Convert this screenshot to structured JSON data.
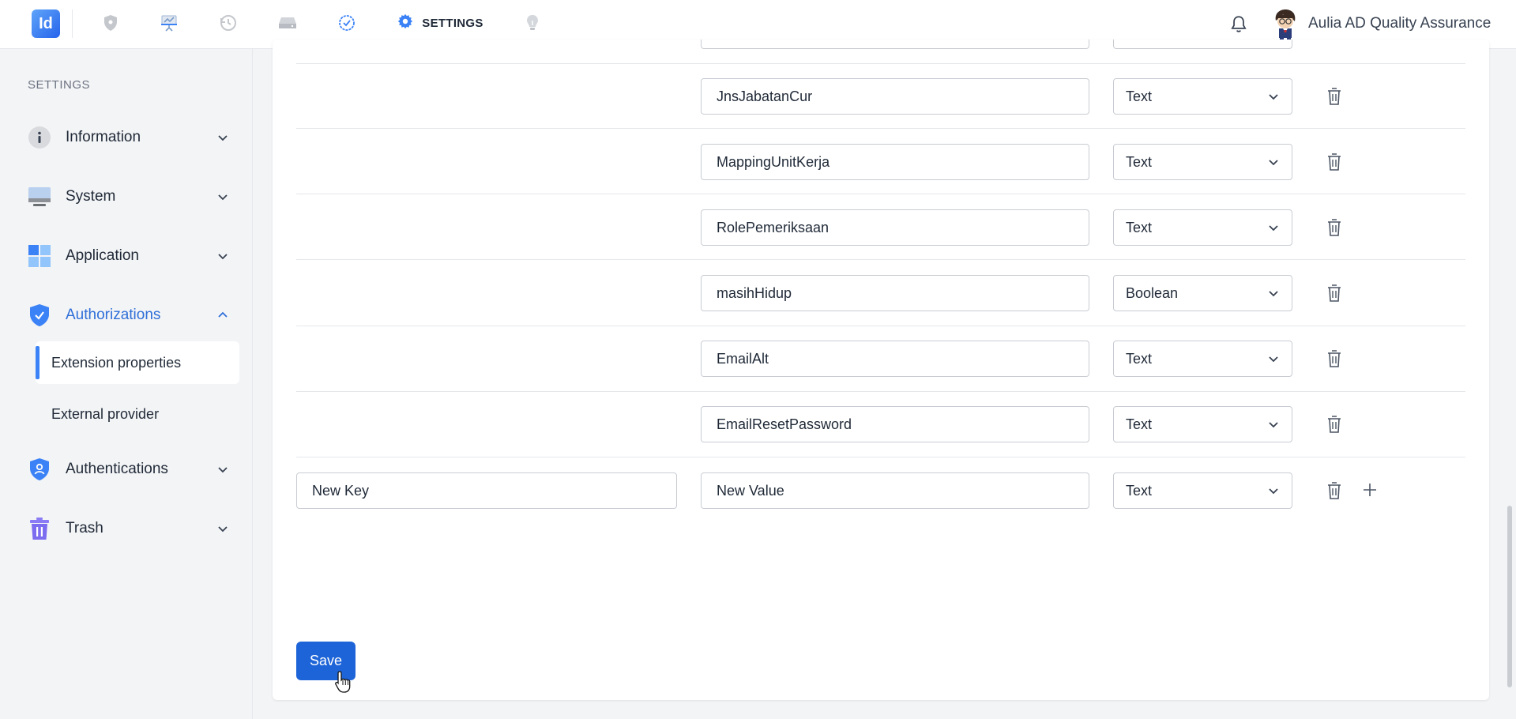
{
  "app": {
    "logo_text": "Id",
    "settings_tab_label": "SETTINGS",
    "user_name": "Aulia AD Quality Assurance",
    "accent_color": "#1d64d8",
    "nav_icons": [
      "shield-icon",
      "presentation-icon",
      "history-icon",
      "drive-icon",
      "check-circle-icon",
      "settings-gear-icon",
      "lightbulb-icon"
    ]
  },
  "sidebar": {
    "heading": "SETTINGS",
    "items": [
      {
        "label": "Information",
        "icon": "info-icon"
      },
      {
        "label": "System",
        "icon": "monitor-icon"
      },
      {
        "label": "Application",
        "icon": "grid-icon"
      },
      {
        "label": "Authorizations",
        "icon": "shield-check-icon",
        "expanded": true
      },
      {
        "label": "Authentications",
        "icon": "shield-user-icon"
      },
      {
        "label": "Trash",
        "icon": "trash-icon"
      }
    ],
    "sub_items": [
      {
        "label": "Extension properties",
        "active": true
      },
      {
        "label": "External provider"
      }
    ]
  },
  "properties": {
    "rows": [
      {
        "value": "JnsJabatanCur",
        "type": "Text"
      },
      {
        "value": "MappingUnitKerja",
        "type": "Text"
      },
      {
        "value": "RolePemeriksaan",
        "type": "Text"
      },
      {
        "value": "masihHidup",
        "type": "Boolean"
      },
      {
        "value": "EmailAlt",
        "type": "Text"
      },
      {
        "value": "EmailResetPassword",
        "type": "Text"
      }
    ],
    "new_row": {
      "key_value": "New Key",
      "value_value": "New Value",
      "type": "Text"
    },
    "save_label": "Save"
  }
}
